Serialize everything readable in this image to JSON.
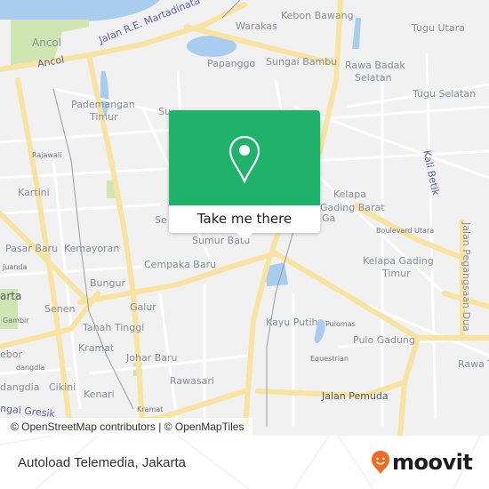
{
  "map": {
    "labels": {
      "ancol_park": "Ancol",
      "ancol_road": "Ancol",
      "martadinata": "Jalan R.E. Martadinata",
      "warakas": "Warakas",
      "kebon_bawang": "Kebon Bawang",
      "tugu_utara": "Tugu Utara",
      "papanggo": "Papanggo",
      "sungai_bambu": "Sungai Bambu",
      "rawa_badak": "Rawa Badak",
      "selatan": "Selatan",
      "tugu_selatan": "Tugu Selatan",
      "pademangan": "Pademangan",
      "timur": "Timur",
      "sunter": "Su",
      "rajawali": "Rajawali",
      "kali_betik": "Kali Betik",
      "kartini": "Kartini",
      "kelapa_gading_barat_1": "Kelapa",
      "kelapa_gading_barat_2": "Gading Barat",
      "se": "Se",
      "ga": "Ga",
      "boulevard_utara": "Boulevard Utara",
      "jalan_pegangsaan_dua": "Jalan Pegangsaan Dua",
      "sumur_batu": "Sumur Batu",
      "pasar_baru": "Pasar Baru",
      "kemayoran": "Kemayoran",
      "juanda": "Juanda",
      "cempaka_baru": "Cempaka Baru",
      "kelapa_gading_timur_1": "Kelapa Gading",
      "kelapa_gading_timur_2": "Timur",
      "jakarta": "arta",
      "bungur": "Bungur",
      "gambir": "Gambir",
      "senen": "Senen",
      "galur": "Galur",
      "kayu_putih": "Kayu Putih",
      "pulomas": "Pulomas",
      "tanah_tinggi": "Tanah Tinggi",
      "pulo_gadung": "Pulo Gadung",
      "kebon": "ebor",
      "kramat": "Kramat",
      "johar_baru": "Johar Baru",
      "equestrian": "Equestrian",
      "rawa_t": "Rawa T",
      "gondangdia_sm": "dangdia",
      "gondangdia": "dangdia",
      "cikini": "Cikini",
      "rawasari": "Rawasari",
      "kenari": "Kenari",
      "jalan_pemuda": "Jalan Pemuda",
      "sungai_gresik": "ngai Gresik",
      "kramat_sm": "Kramat"
    },
    "attribution": "© OpenStreetMap contributors | © OpenMapTiles"
  },
  "popup": {
    "button_label": "Take me there",
    "icon": "map-pin-icon",
    "color": "#1fb26b"
  },
  "footer": {
    "place_title": "Autoload Telemedia, Jakarta",
    "brand": "moovit",
    "brand_color": "#f26a21"
  }
}
